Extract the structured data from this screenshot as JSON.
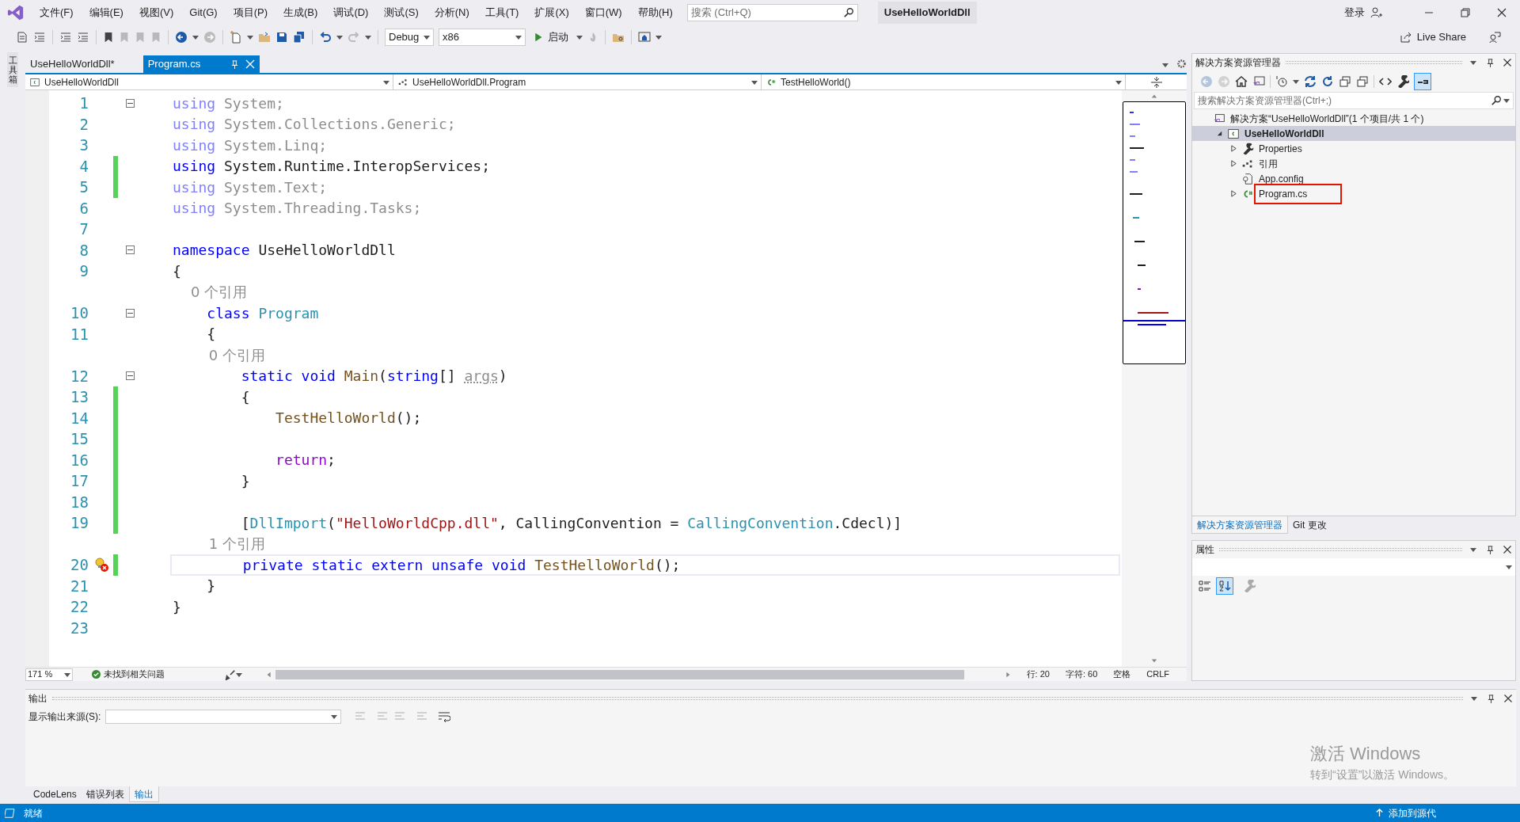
{
  "window": {
    "title": "UseHelloWorldDll",
    "search_placeholder": "搜索 (Ctrl+Q)",
    "sign_in": "登录"
  },
  "menu": [
    "文件(F)",
    "编辑(E)",
    "视图(V)",
    "Git(G)",
    "项目(P)",
    "生成(B)",
    "调试(D)",
    "测试(S)",
    "分析(N)",
    "工具(T)",
    "扩展(X)",
    "窗口(W)",
    "帮助(H)"
  ],
  "toolbar": {
    "configuration": "Debug",
    "platform": "x86",
    "start": "启动",
    "live_share": "Live Share"
  },
  "toolbox_strip": "工具箱",
  "tabs": [
    {
      "label": "UseHelloWorldDll*",
      "selected": false
    },
    {
      "label": "Program.cs",
      "selected": true
    }
  ],
  "nav_bar": [
    "UseHelloWorldDll",
    "UseHelloWorldDll.Program",
    "TestHelloWorld()"
  ],
  "code": [
    {
      "kind": "code",
      "number": "1",
      "changed": false,
      "fold": true,
      "current": false,
      "tokens": [
        {
          "kind": "kw_faded",
          "text": "using"
        },
        {
          "kind": "faded",
          "text": " System;"
        }
      ]
    },
    {
      "kind": "code",
      "number": "2",
      "changed": false,
      "fold": false,
      "current": false,
      "tokens": [
        {
          "kind": "kw_faded",
          "text": "using"
        },
        {
          "kind": "faded",
          "text": " System.Collections.Generic;"
        }
      ]
    },
    {
      "kind": "code",
      "number": "3",
      "changed": false,
      "fold": false,
      "current": false,
      "tokens": [
        {
          "kind": "kw_faded",
          "text": "using"
        },
        {
          "kind": "faded",
          "text": " System.Linq;"
        }
      ]
    },
    {
      "kind": "code",
      "number": "4",
      "changed": true,
      "fold": false,
      "current": false,
      "tokens": [
        {
          "kind": "kw",
          "text": "using"
        },
        {
          "kind": "plain",
          "text": " System.Runtime.InteropServices;"
        }
      ]
    },
    {
      "kind": "code",
      "number": "5",
      "changed": true,
      "fold": false,
      "current": false,
      "tokens": [
        {
          "kind": "kw_faded",
          "text": "using"
        },
        {
          "kind": "faded",
          "text": " System.Text;"
        }
      ]
    },
    {
      "kind": "code",
      "number": "6",
      "changed": false,
      "fold": false,
      "current": false,
      "tokens": [
        {
          "kind": "kw_faded",
          "text": "using"
        },
        {
          "kind": "faded",
          "text": " System.Threading.Tasks;"
        }
      ]
    },
    {
      "kind": "code",
      "number": "7",
      "changed": false,
      "fold": false,
      "current": false
    },
    {
      "kind": "code",
      "number": "8",
      "changed": false,
      "fold": true,
      "current": false,
      "tokens": [
        {
          "kind": "kw",
          "text": "namespace"
        },
        {
          "kind": "plain",
          "text": " UseHelloWorldDll"
        }
      ]
    },
    {
      "kind": "code",
      "number": "9",
      "changed": false,
      "fold": false,
      "current": false,
      "tokens": [
        {
          "kind": "plain",
          "text": "{"
        }
      ]
    },
    {
      "kind": "lens",
      "text": "    0 个引用"
    },
    {
      "kind": "code",
      "number": "10",
      "changed": false,
      "fold": true,
      "current": false,
      "tokens": [
        {
          "kind": "kw",
          "text": "    class"
        },
        {
          "kind": "type",
          "text": " Program"
        }
      ]
    },
    {
      "kind": "code",
      "number": "11",
      "changed": false,
      "fold": false,
      "current": false,
      "tokens": [
        {
          "kind": "plain",
          "text": "    {"
        }
      ]
    },
    {
      "kind": "lens",
      "text": "        0 个引用"
    },
    {
      "kind": "code",
      "number": "12",
      "changed": false,
      "fold": true,
      "current": false,
      "tokens": [
        {
          "kind": "kw",
          "text": "        static void"
        },
        {
          "kind": "method",
          "text": " Main"
        },
        {
          "kind": "plain",
          "text": "("
        },
        {
          "kind": "kw",
          "text": "string"
        },
        {
          "kind": "plain",
          "text": "[] "
        },
        {
          "kind": "unused",
          "text": "args"
        },
        {
          "kind": "plain",
          "text": ")"
        }
      ]
    },
    {
      "kind": "code",
      "number": "13",
      "changed": true,
      "fold": false,
      "current": false,
      "tokens": [
        {
          "kind": "plain",
          "text": "        {"
        }
      ]
    },
    {
      "kind": "code",
      "number": "14",
      "changed": true,
      "fold": false,
      "current": false,
      "tokens": [
        {
          "kind": "method",
          "text": "            TestHelloWorld"
        },
        {
          "kind": "plain",
          "text": "();"
        }
      ]
    },
    {
      "kind": "code",
      "number": "15",
      "changed": true,
      "fold": false,
      "current": false
    },
    {
      "kind": "code",
      "number": "16",
      "changed": true,
      "fold": false,
      "current": false,
      "tokens": [
        {
          "kind": "control",
          "text": "            return"
        },
        {
          "kind": "plain",
          "text": ";"
        }
      ]
    },
    {
      "kind": "code",
      "number": "17",
      "changed": true,
      "fold": false,
      "current": false,
      "tokens": [
        {
          "kind": "plain",
          "text": "        }"
        }
      ]
    },
    {
      "kind": "code",
      "number": "18",
      "changed": true,
      "fold": false,
      "current": false
    },
    {
      "kind": "code",
      "number": "19",
      "changed": true,
      "fold": false,
      "current": false,
      "tokens": [
        {
          "kind": "plain",
          "text": "        ["
        },
        {
          "kind": "type",
          "text": "DllImport"
        },
        {
          "kind": "plain",
          "text": "("
        },
        {
          "kind": "string",
          "text": "\"HelloWorldCpp.dll\""
        },
        {
          "kind": "plain",
          "text": ", CallingConvention = "
        },
        {
          "kind": "type",
          "text": "CallingConvention"
        },
        {
          "kind": "plain",
          "text": ".Cdecl)]"
        }
      ]
    },
    {
      "kind": "lens",
      "text": "        1 个引用"
    },
    {
      "kind": "code",
      "number": "20",
      "changed": true,
      "fold": false,
      "current": true,
      "tokens": [
        {
          "kind": "kw",
          "text": "        private static extern unsafe void"
        },
        {
          "kind": "method",
          "text": " TestHelloWorld"
        },
        {
          "kind": "plain",
          "text": "();"
        }
      ]
    },
    {
      "kind": "code",
      "number": "21",
      "changed": false,
      "fold": false,
      "current": false,
      "tokens": [
        {
          "kind": "plain",
          "text": "    }"
        }
      ]
    },
    {
      "kind": "code",
      "number": "22",
      "changed": false,
      "fold": false,
      "current": false,
      "tokens": [
        {
          "kind": "plain",
          "text": "}"
        }
      ]
    },
    {
      "kind": "code",
      "number": "23",
      "changed": false,
      "fold": false,
      "current": false
    }
  ],
  "editor_status": {
    "zoom": "171 %",
    "issues": "未找到相关问题",
    "line": "行: 20",
    "column": "字符: 60",
    "whitespace": "空格",
    "line_ending": "CRLF"
  },
  "solution_explorer": {
    "title": "解决方案资源管理器",
    "search_placeholder": "搜索解决方案资源管理器(Ctrl+;)",
    "tree": [
      {
        "label": "解决方案“UseHelloWorldDll”(1 个项目/共 1 个)",
        "kind": "solution",
        "selected": false,
        "outlined": false,
        "children": [
          {
            "label": "UseHelloWorldDll",
            "kind": "project",
            "expanded": true,
            "selected": true,
            "outlined": false,
            "children": [
              {
                "label": "Properties",
                "kind": "wrench",
                "expanded": false,
                "selected": false,
                "outlined": false
              },
              {
                "label": "引用",
                "kind": "references",
                "expanded": false,
                "selected": false,
                "outlined": false
              },
              {
                "label": "App.config",
                "kind": "config",
                "selected": false,
                "outlined": false
              },
              {
                "label": "Program.cs",
                "kind": "csharp",
                "expanded": false,
                "selected": false,
                "outlined": true
              }
            ]
          }
        ]
      }
    ],
    "tabs": [
      {
        "label": "解决方案资源管理器",
        "selected": true
      },
      {
        "label": "Git 更改",
        "selected": false
      }
    ]
  },
  "properties": {
    "title": "属性"
  },
  "output": {
    "title": "输出",
    "source_label": "显示输出来源(S):"
  },
  "bottom_tabs": [
    {
      "label": "CodeLens",
      "selected": false
    },
    {
      "label": "错误列表",
      "selected": false
    },
    {
      "label": "输出",
      "selected": true
    }
  ],
  "activation": {
    "title": "激活 Windows",
    "hint": "转到“设置”以激活 Windows。"
  },
  "status_bar": {
    "text": "就绪",
    "source_control": "添加到源代"
  }
}
